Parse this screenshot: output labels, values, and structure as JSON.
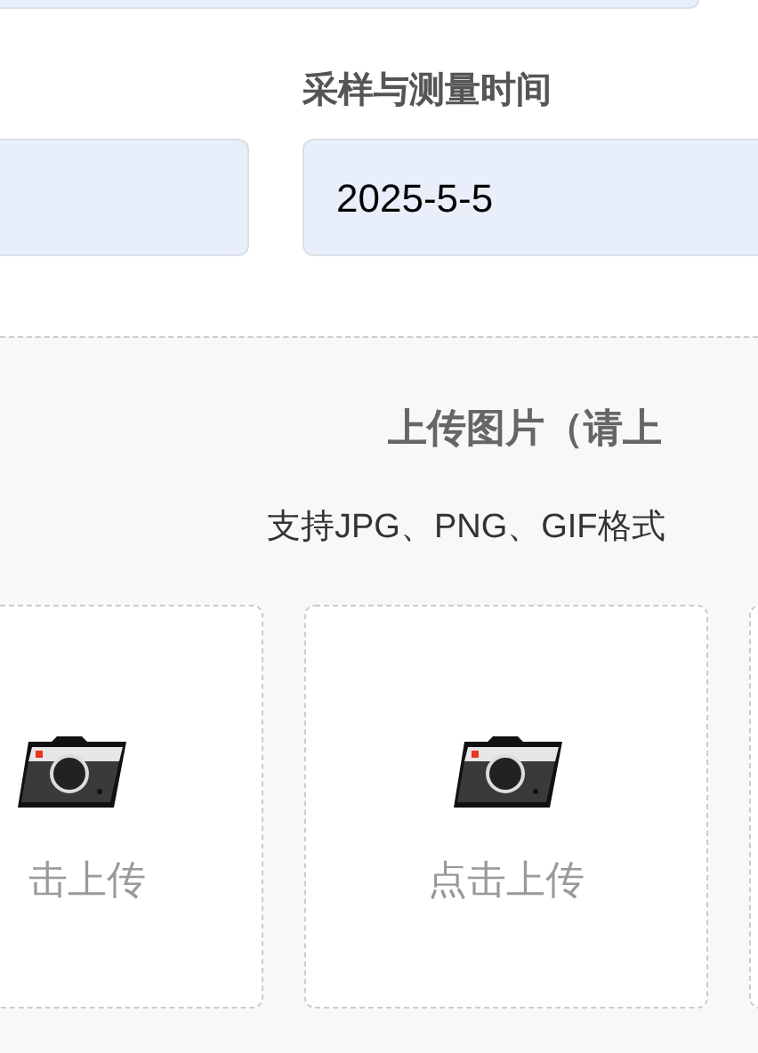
{
  "form_fields": [
    {
      "kind": "unlabeled"
    },
    {
      "kind": "labeled",
      "label": "采样与测量时间",
      "value": "2025-5-5"
    }
  ],
  "upload": {
    "title": "上传图片（请上",
    "hint": "支持JPG、PNG、GIF格式",
    "cards": [
      {
        "label": "击上传"
      },
      {
        "label": "点击上传"
      }
    ]
  }
}
